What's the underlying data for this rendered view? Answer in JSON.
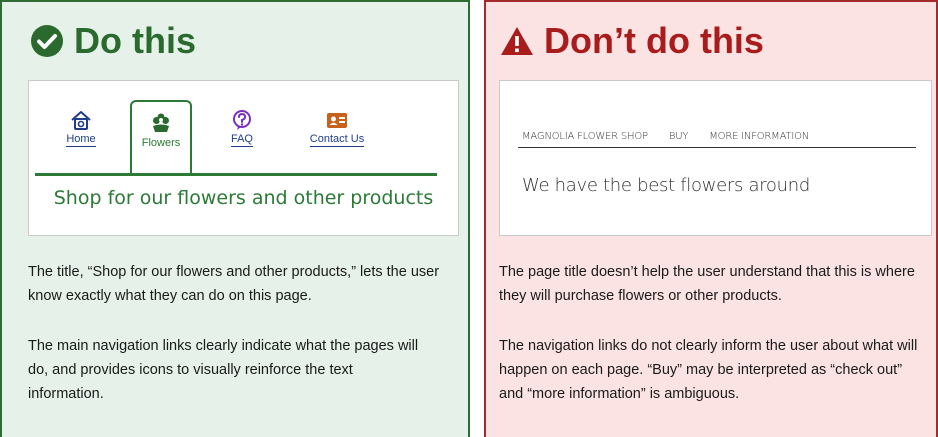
{
  "good": {
    "heading": "Do this",
    "nav": {
      "home": "Home",
      "flowers": "Flowers",
      "faq": "FAQ",
      "contact": "Contact Us"
    },
    "page_title": "Shop for our flowers and other products",
    "paragraph1": "The title, “Shop for our flowers and other products,” lets the user know exactly what they can do on this page.",
    "paragraph2": "The main navigation links clearly indicate what the pages will do, and provides icons to visually reinforce the text information."
  },
  "bad": {
    "heading": "Don’t do this",
    "nav": {
      "shop": "MAGNOLIA FLOWER SHOP",
      "buy": "BUY",
      "more": "MORE INFORMATION"
    },
    "page_title": "We have the best flowers around",
    "paragraph1": "The page title doesn’t help the user understand that this is where they will purchase flowers or other products.",
    "paragraph2": "The navigation links do not clearly inform the user about what will happen on each page. “Buy” may be interpreted as “check out” and “more information” is ambiguous."
  },
  "colors": {
    "good_accent": "#2b7a36",
    "bad_accent": "#a81c1c",
    "link": "#1f3d8a",
    "faq_icon": "#7b2fbf",
    "contact_icon": "#c8621a"
  }
}
